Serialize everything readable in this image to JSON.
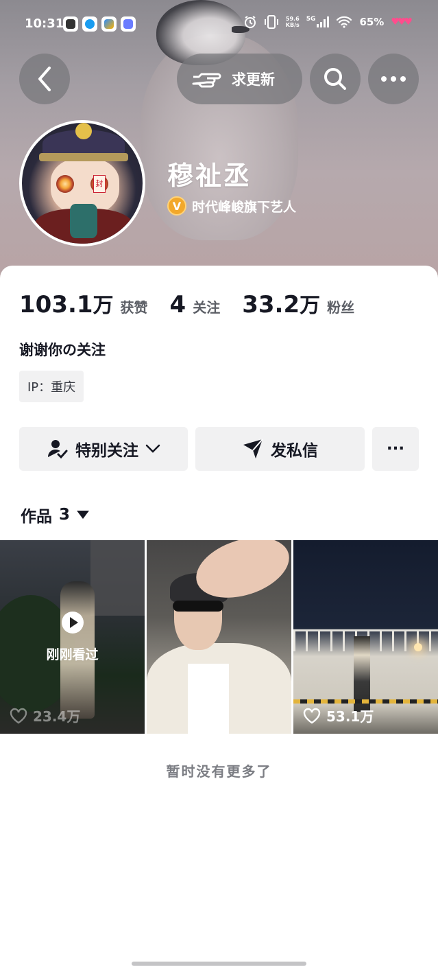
{
  "status_bar": {
    "time": "10:31",
    "net_speed": "59.6",
    "net_unit": "KB/s",
    "network": "5G",
    "battery": "65%",
    "heart_icons": "♥♥♥"
  },
  "nav": {
    "back_icon": "chevron-left-icon",
    "request_update_label": "求更新",
    "search_icon": "search-icon",
    "more_icon": "more-dots-icon"
  },
  "profile": {
    "name": "穆祉丞",
    "verified_label": "时代峰峻旗下艺人",
    "verified_badge": "V",
    "avatar_seal": "封"
  },
  "stats": [
    {
      "num": "103.1",
      "unit": "万",
      "label": "获赞"
    },
    {
      "num": "4",
      "unit": "",
      "label": "关注"
    },
    {
      "num": "33.2",
      "unit": "万",
      "label": "粉丝"
    }
  ],
  "bio": "谢谢你の关注",
  "ip_label": "IP：重庆",
  "actions": {
    "follow_label": "特别关注",
    "message_label": "发私信",
    "more_label": "···"
  },
  "works": {
    "label": "作品",
    "count": "3",
    "items": [
      {
        "likes": "23.4万",
        "overlay": "刚刚看过"
      },
      {
        "likes": "",
        "overlay": ""
      },
      {
        "likes": "53.1万",
        "overlay": ""
      }
    ]
  },
  "empty_note": "暂时没有更多了",
  "colors": {
    "text_primary": "#161823",
    "text_secondary": "#5c5f66",
    "button_bg": "#f1f1f2",
    "verified_gold": "#f2a82b"
  }
}
